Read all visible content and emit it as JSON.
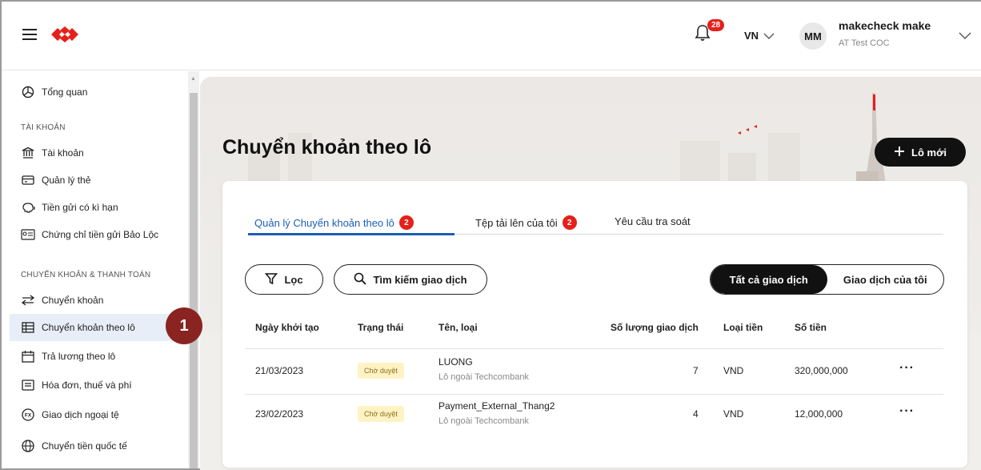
{
  "header": {
    "notification_count": "28",
    "language": "VN",
    "user_initials": "MM",
    "user_name": "makecheck make",
    "user_org": "AT Test COC"
  },
  "sidebar": {
    "items": [
      {
        "label": "Tổng quan",
        "icon": "chart-pie-icon"
      },
      {
        "label": "Tài khoản",
        "icon": "bank-icon"
      },
      {
        "label": "Quản lý thẻ",
        "icon": "card-icon"
      },
      {
        "label": "Tiền gửi có kì hạn",
        "icon": "piggy-bank-icon"
      },
      {
        "label": "Chứng chỉ tiền gửi Bảo Lộc",
        "icon": "certificate-icon"
      },
      {
        "label": "Chuyển khoản",
        "icon": "transfer-icon"
      },
      {
        "label": "Chuyển khoản theo lô",
        "icon": "table-icon"
      },
      {
        "label": "Trả lương theo lô",
        "icon": "calendar-icon"
      },
      {
        "label": "Hóa đơn, thuế và phí",
        "icon": "receipt-icon"
      },
      {
        "label": "Giao dịch ngoại tệ",
        "icon": "fx-icon"
      },
      {
        "label": "Chuyển tiền quốc tế",
        "icon": "globe-icon"
      }
    ],
    "sections": [
      "TÀI KHOẢN",
      "CHUYỂN KHOẢN & THANH TOÁN"
    ]
  },
  "step_marker": "1",
  "page": {
    "title": "Chuyển khoản theo lô",
    "new_button": "Lô mới"
  },
  "tabs": [
    {
      "label": "Quản lý Chuyển khoản theo lô",
      "badge": "2"
    },
    {
      "label": "Tệp tải lên của tôi",
      "badge": "2"
    },
    {
      "label": "Yêu cầu tra soát"
    }
  ],
  "filters": {
    "filter_label": "Lọc",
    "search_label": "Tìm kiếm giao dịch",
    "all_label": "Tất cả giao dịch",
    "mine_label": "Giao dịch của tôi"
  },
  "table": {
    "columns": [
      "Ngày khởi tạo",
      "Trạng thái",
      "Tên, loại",
      "Số lượng giao dịch",
      "Loại tiền",
      "Số tiền"
    ],
    "rows": [
      {
        "date": "21/03/2023",
        "status": "Chờ duyệt",
        "name": "LUONG",
        "type": "Lô ngoài Techcombank",
        "count": "7",
        "currency": "VND",
        "amount": "320,000,000",
        "more": "···"
      },
      {
        "date": "23/02/2023",
        "status": "Chờ duyệt",
        "name": "Payment_External_Thang2",
        "type": "Lô ngoài Techcombank",
        "count": "4",
        "currency": "VND",
        "amount": "12,000,000",
        "more": "···"
      }
    ]
  },
  "colors": {
    "accent": "#1a5fb4",
    "brand_red": "#e5201a",
    "step_badge": "#8a2421",
    "pending_bg": "#fff3c4"
  }
}
